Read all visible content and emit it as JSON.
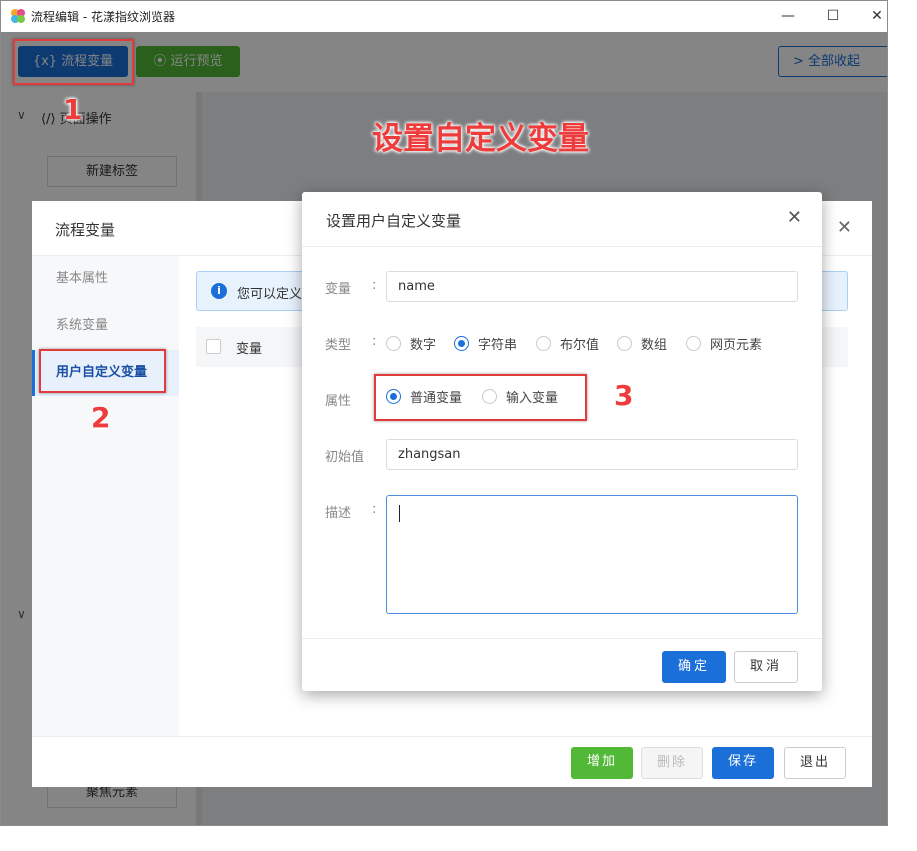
{
  "window": {
    "title": "流程编辑 - 花漾指纹浏览器",
    "minimize": "—",
    "maximize": "☐",
    "close": "✕"
  },
  "toolbar": {
    "flow_var_label": "{x} 流程变量",
    "preview_label": "⦿ 运行预览",
    "collapse_label": "> 全部收起"
  },
  "leftpanel": {
    "group_label": "⟨/⟩ 页面操作",
    "new_tag_label": "新建标签",
    "focus_label": "聚焦元素"
  },
  "mid_dialog": {
    "title": "流程变量",
    "close": "✕",
    "nav": [
      "基本属性",
      "系统变量",
      "用户自定义变量"
    ],
    "info_text": "您可以定义",
    "table_header": "变量",
    "buttons": {
      "add": "增加",
      "delete": "删除",
      "save": "保存",
      "exit": "退出"
    }
  },
  "dialog": {
    "title": "设置用户自定义变量",
    "close": "✕",
    "var_label": "变量",
    "var_value": "name",
    "type_label": "类型",
    "types": [
      "数字",
      "字符串",
      "布尔值",
      "数组",
      "网页元素"
    ],
    "type_selected": "字符串",
    "attr_label": "属性",
    "attrs": [
      "普通变量",
      "输入变量"
    ],
    "attr_selected": "普通变量",
    "init_label": "初始值",
    "init_value": "zhangsan",
    "desc_label": "描述",
    "desc_value": "",
    "colon": ":",
    "ok": "确定",
    "cancel": "取消"
  },
  "annotations": {
    "title": "设置自定义变量",
    "n1": "1",
    "n2": "2",
    "n3": "3"
  },
  "colors": {
    "primary": "#1a6fd8",
    "success": "#52b837",
    "annotation": "#ee3b3b"
  }
}
